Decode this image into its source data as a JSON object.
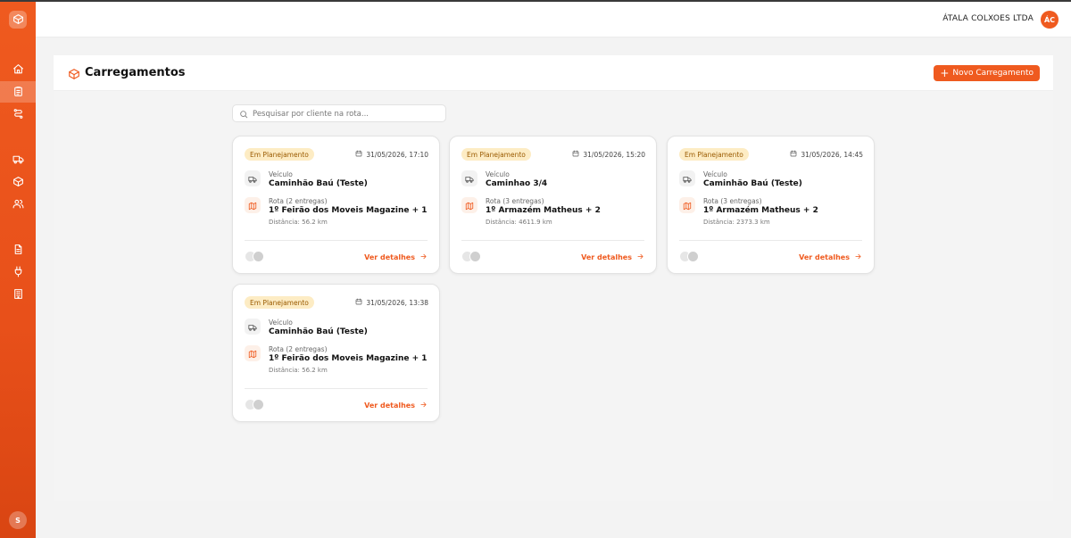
{
  "header": {
    "company": "ÁTALA COLXOES LTDA",
    "user_initials": "ÁC"
  },
  "sidebar": {
    "logo_icon": "package-icon",
    "items": [
      {
        "icon": "home-icon",
        "active": false
      },
      {
        "icon": "clipboard-icon",
        "active": true
      },
      {
        "icon": "route-icon",
        "active": false
      },
      {
        "icon": "truck-icon",
        "active": false
      },
      {
        "icon": "package-icon",
        "active": false
      },
      {
        "icon": "users-icon",
        "active": false
      },
      {
        "icon": "file-text-icon",
        "active": false
      },
      {
        "icon": "plug-icon",
        "active": false
      },
      {
        "icon": "building-icon",
        "active": false
      }
    ],
    "user_initial": "S"
  },
  "page": {
    "title": "Carregamentos",
    "new_button": "Novo Carregamento",
    "search_placeholder": "Pesquisar por cliente na rota..."
  },
  "cards": [
    {
      "status": "Em Planejamento",
      "date": "31/05/2026, 17:10",
      "vehicle_label": "Veículo",
      "vehicle": "Caminhão Baú (Teste)",
      "route_label": "Rota (2 entregas)",
      "route": "1º Feirão dos Moveis Magazine + 1",
      "distance": "Distância: 56.2 km",
      "details": "Ver detalhes"
    },
    {
      "status": "Em Planejamento",
      "date": "31/05/2026, 15:20",
      "vehicle_label": "Veículo",
      "vehicle": "Caminhao 3/4",
      "route_label": "Rota (3 entregas)",
      "route": "1º Armazém Matheus + 2",
      "distance": "Distância: 4611.9 km",
      "details": "Ver detalhes"
    },
    {
      "status": "Em Planejamento",
      "date": "31/05/2026, 14:45",
      "vehicle_label": "Veículo",
      "vehicle": "Caminhão Baú (Teste)",
      "route_label": "Rota (3 entregas)",
      "route": "1º Armazém Matheus + 2",
      "distance": "Distância: 2373.3 km",
      "details": "Ver detalhes"
    },
    {
      "status": "Em Planejamento",
      "date": "31/05/2026, 13:38",
      "vehicle_label": "Veículo",
      "vehicle": "Caminhão Baú (Teste)",
      "route_label": "Rota (2 entregas)",
      "route": "1º Feirão dos Moveis Magazine + 1",
      "distance": "Distância: 56.2 km",
      "details": "Ver detalhes"
    }
  ],
  "colors": {
    "accent": "#ef5a1f",
    "badge_bg": "#fdecc4",
    "badge_text": "#9a5a00"
  }
}
